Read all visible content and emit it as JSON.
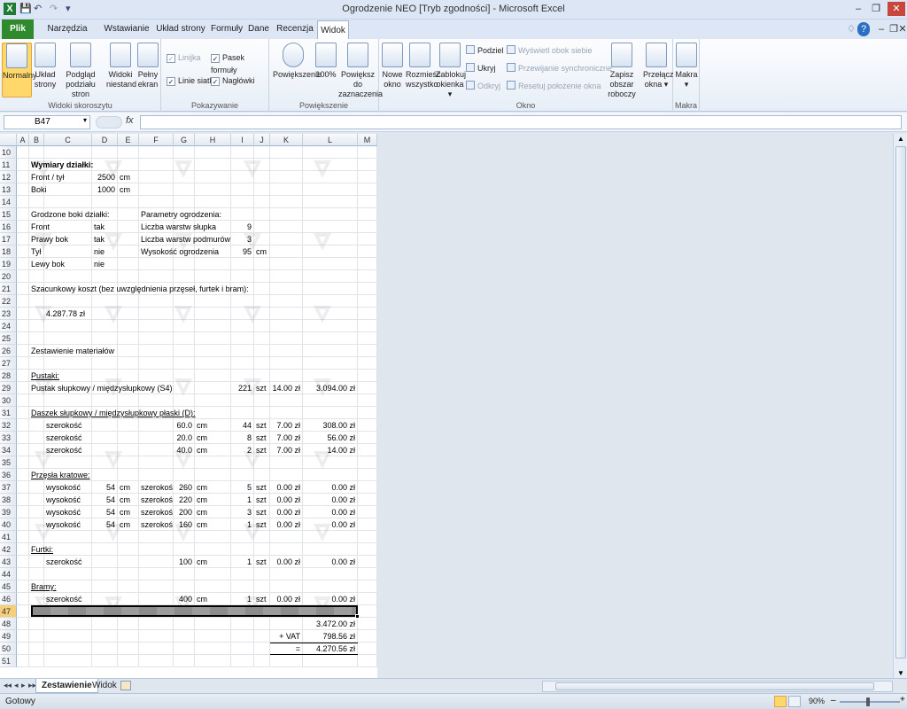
{
  "window": {
    "title": "Ogrodzenie NEO  [Tryb zgodności] - Microsoft Excel",
    "qat": [
      "X",
      "💾",
      "↶",
      "↷",
      "▾"
    ],
    "controls": [
      "–",
      "❐",
      "✕"
    ],
    "ribbon_controls": [
      "♢",
      "?",
      "–",
      "❐",
      "✕"
    ]
  },
  "tabs": [
    "Plik",
    "Narzędzia główne",
    "Wstawianie",
    "Układ strony",
    "Formuły",
    "Dane",
    "Recenzja",
    "Widok"
  ],
  "ribbon": {
    "groups": {
      "views": {
        "label": "Widoki skoroszytu",
        "buttons": [
          "Normalny",
          "Układ strony",
          "Podgląd podziału stron",
          "Widoki niestand",
          "Pełny ekran"
        ]
      },
      "show": {
        "label": "Pokazywanie",
        "ruler": "Linijka",
        "formula_bar": "Pasek formuły",
        "gridlines": "Linie siatki",
        "headings": "Nagłówki"
      },
      "zoom": {
        "label": "Powiększenie",
        "buttons": [
          "Powiększenie",
          "100%",
          "Powiększ do zaznaczenia"
        ]
      },
      "window": {
        "label": "Okno",
        "buttons": [
          "Nowe okno",
          "Rozmieść wszystko",
          "Zablokuj okienka ▾"
        ],
        "split": "Podziel",
        "hide": "Ukryj",
        "unhide": "Odkryj",
        "side_by_side": "Wyświetl obok siebie",
        "sync_scroll": "Przewijanie synchroniczne",
        "reset_pos": "Resetuj położenie okna",
        "save_ws": "Zapisz obszar roboczy",
        "switch": "Przełącz okna ▾"
      },
      "macros": {
        "label": "Makra",
        "button": "Makra ▾"
      }
    }
  },
  "formula_bar": {
    "name_box": "B47",
    "fx": "fx",
    "formula": ""
  },
  "columns": [
    "A",
    "B",
    "C",
    "D",
    "E",
    "F",
    "G",
    "H",
    "I",
    "J",
    "K",
    "L",
    "M"
  ],
  "rows": [
    "10",
    "11",
    "12",
    "13",
    "14",
    "15",
    "16",
    "17",
    "18",
    "19",
    "20",
    "21",
    "22",
    "23",
    "24",
    "25",
    "26",
    "27",
    "28",
    "29",
    "30",
    "31",
    "32",
    "33",
    "34",
    "35",
    "36",
    "37",
    "38",
    "39",
    "40",
    "41",
    "42",
    "43",
    "44",
    "45",
    "46",
    "47",
    "48",
    "49",
    "50",
    "51"
  ],
  "cells": [
    {
      "row": "11",
      "col": "B",
      "text": "Wymiary działki:",
      "b": true
    },
    {
      "row": "12",
      "col": "B",
      "text": "Front / tył"
    },
    {
      "row": "12",
      "col": "D",
      "text": "2500",
      "r": true
    },
    {
      "row": "12",
      "col": "E",
      "text": "cm"
    },
    {
      "row": "13",
      "col": "B",
      "text": "Boki"
    },
    {
      "row": "13",
      "col": "D",
      "text": "1000",
      "r": true
    },
    {
      "row": "13",
      "col": "E",
      "text": "cm"
    },
    {
      "row": "15",
      "col": "B",
      "text": "Grodzone boki działki:"
    },
    {
      "row": "15",
      "col": "F",
      "text": "Parametry ogrodzenia:"
    },
    {
      "row": "16",
      "col": "B",
      "text": "Front"
    },
    {
      "row": "16",
      "col": "D",
      "text": "tak"
    },
    {
      "row": "16",
      "col": "F",
      "text": "Liczba warstw słupka"
    },
    {
      "row": "16",
      "col": "I",
      "text": "9",
      "r": true
    },
    {
      "row": "17",
      "col": "B",
      "text": "Prawy bok"
    },
    {
      "row": "17",
      "col": "D",
      "text": "tak"
    },
    {
      "row": "17",
      "col": "F",
      "text": "Liczba warstw podmurówki"
    },
    {
      "row": "17",
      "col": "I",
      "text": "3",
      "r": true
    },
    {
      "row": "18",
      "col": "B",
      "text": "Tył"
    },
    {
      "row": "18",
      "col": "D",
      "text": "nie"
    },
    {
      "row": "18",
      "col": "F",
      "text": "Wysokość ogrodzenia"
    },
    {
      "row": "18",
      "col": "I",
      "text": "95",
      "r": true
    },
    {
      "row": "18",
      "col": "J",
      "text": "cm"
    },
    {
      "row": "19",
      "col": "B",
      "text": "Lewy bok"
    },
    {
      "row": "19",
      "col": "D",
      "text": "nie"
    },
    {
      "row": "21",
      "col": "B",
      "text": "Szacunkowy koszt (bez uwzględnienia przęseł, furtek i bram):"
    },
    {
      "row": "23",
      "col": "C",
      "text": "4.287.78 zł"
    },
    {
      "row": "26",
      "col": "B",
      "text": "Zestawienie materiałów"
    },
    {
      "row": "28",
      "col": "B",
      "text": "Pustaki:",
      "u": true
    },
    {
      "row": "29",
      "col": "B",
      "text": "Pustak słupkowy / międzysłupkowy (S4)"
    },
    {
      "row": "29",
      "col": "I",
      "text": "221",
      "r": true
    },
    {
      "row": "29",
      "col": "J",
      "text": "szt"
    },
    {
      "row": "29",
      "col": "K",
      "text": "14.00 zł",
      "r": true
    },
    {
      "row": "29",
      "col": "L",
      "text": "3.094.00 zł",
      "r": true
    },
    {
      "row": "31",
      "col": "B",
      "text": "Daszek słupkowy / międzysłupkowy płaski (D):",
      "u": true
    },
    {
      "row": "32",
      "col": "C",
      "text": "szerokość"
    },
    {
      "row": "32",
      "col": "G",
      "text": "60.0",
      "r": true
    },
    {
      "row": "32",
      "col": "H",
      "text": "cm"
    },
    {
      "row": "32",
      "col": "I",
      "text": "44",
      "r": true
    },
    {
      "row": "32",
      "col": "J",
      "text": "szt"
    },
    {
      "row": "32",
      "col": "K",
      "text": "7.00 zł",
      "r": true
    },
    {
      "row": "32",
      "col": "L",
      "text": "308.00 zł",
      "r": true
    },
    {
      "row": "33",
      "col": "C",
      "text": "szerokość"
    },
    {
      "row": "33",
      "col": "G",
      "text": "20.0",
      "r": true
    },
    {
      "row": "33",
      "col": "H",
      "text": "cm"
    },
    {
      "row": "33",
      "col": "I",
      "text": "8",
      "r": true
    },
    {
      "row": "33",
      "col": "J",
      "text": "szt"
    },
    {
      "row": "33",
      "col": "K",
      "text": "7.00 zł",
      "r": true
    },
    {
      "row": "33",
      "col": "L",
      "text": "56.00 zł",
      "r": true
    },
    {
      "row": "34",
      "col": "C",
      "text": "szerokość"
    },
    {
      "row": "34",
      "col": "G",
      "text": "40.0",
      "r": true
    },
    {
      "row": "34",
      "col": "H",
      "text": "cm"
    },
    {
      "row": "34",
      "col": "I",
      "text": "2",
      "r": true
    },
    {
      "row": "34",
      "col": "J",
      "text": "szt"
    },
    {
      "row": "34",
      "col": "K",
      "text": "7.00 zł",
      "r": true
    },
    {
      "row": "34",
      "col": "L",
      "text": "14.00 zł",
      "r": true
    },
    {
      "row": "36",
      "col": "B",
      "text": "Przęsła kratowe:",
      "u": true
    },
    {
      "row": "37",
      "col": "C",
      "text": "wysokość"
    },
    {
      "row": "37",
      "col": "D",
      "text": "54",
      "r": true
    },
    {
      "row": "37",
      "col": "E",
      "text": "cm"
    },
    {
      "row": "37",
      "col": "F",
      "text": "szerokość"
    },
    {
      "row": "37",
      "col": "G",
      "text": "260",
      "r": true
    },
    {
      "row": "37",
      "col": "H",
      "text": "cm"
    },
    {
      "row": "37",
      "col": "I",
      "text": "5",
      "r": true
    },
    {
      "row": "37",
      "col": "J",
      "text": "szt"
    },
    {
      "row": "37",
      "col": "K",
      "text": "0.00 zł",
      "r": true
    },
    {
      "row": "37",
      "col": "L",
      "text": "0.00 zł",
      "r": true
    },
    {
      "row": "38",
      "col": "C",
      "text": "wysokość"
    },
    {
      "row": "38",
      "col": "D",
      "text": "54",
      "r": true
    },
    {
      "row": "38",
      "col": "E",
      "text": "cm"
    },
    {
      "row": "38",
      "col": "F",
      "text": "szerokość"
    },
    {
      "row": "38",
      "col": "G",
      "text": "220",
      "r": true
    },
    {
      "row": "38",
      "col": "H",
      "text": "cm"
    },
    {
      "row": "38",
      "col": "I",
      "text": "1",
      "r": true
    },
    {
      "row": "38",
      "col": "J",
      "text": "szt"
    },
    {
      "row": "38",
      "col": "K",
      "text": "0.00 zł",
      "r": true
    },
    {
      "row": "38",
      "col": "L",
      "text": "0.00 zł",
      "r": true
    },
    {
      "row": "39",
      "col": "C",
      "text": "wysokość"
    },
    {
      "row": "39",
      "col": "D",
      "text": "54",
      "r": true
    },
    {
      "row": "39",
      "col": "E",
      "text": "cm"
    },
    {
      "row": "39",
      "col": "F",
      "text": "szerokość"
    },
    {
      "row": "39",
      "col": "G",
      "text": "200",
      "r": true
    },
    {
      "row": "39",
      "col": "H",
      "text": "cm"
    },
    {
      "row": "39",
      "col": "I",
      "text": "3",
      "r": true
    },
    {
      "row": "39",
      "col": "J",
      "text": "szt"
    },
    {
      "row": "39",
      "col": "K",
      "text": "0.00 zł",
      "r": true
    },
    {
      "row": "39",
      "col": "L",
      "text": "0.00 zł",
      "r": true
    },
    {
      "row": "40",
      "col": "C",
      "text": "wysokość"
    },
    {
      "row": "40",
      "col": "D",
      "text": "54",
      "r": true
    },
    {
      "row": "40",
      "col": "E",
      "text": "cm"
    },
    {
      "row": "40",
      "col": "F",
      "text": "szerokość"
    },
    {
      "row": "40",
      "col": "G",
      "text": "160",
      "r": true
    },
    {
      "row": "40",
      "col": "H",
      "text": "cm"
    },
    {
      "row": "40",
      "col": "I",
      "text": "1",
      "r": true
    },
    {
      "row": "40",
      "col": "J",
      "text": "szt"
    },
    {
      "row": "40",
      "col": "K",
      "text": "0.00 zł",
      "r": true
    },
    {
      "row": "40",
      "col": "L",
      "text": "0.00 zł",
      "r": true
    },
    {
      "row": "42",
      "col": "B",
      "text": "Furtki:",
      "u": true
    },
    {
      "row": "43",
      "col": "C",
      "text": "szerokość"
    },
    {
      "row": "43",
      "col": "G",
      "text": "100",
      "r": true
    },
    {
      "row": "43",
      "col": "H",
      "text": "cm"
    },
    {
      "row": "43",
      "col": "I",
      "text": "1",
      "r": true
    },
    {
      "row": "43",
      "col": "J",
      "text": "szt"
    },
    {
      "row": "43",
      "col": "K",
      "text": "0.00 zł",
      "r": true
    },
    {
      "row": "43",
      "col": "L",
      "text": "0.00 zł",
      "r": true
    },
    {
      "row": "45",
      "col": "B",
      "text": "Bramy:",
      "u": true
    },
    {
      "row": "46",
      "col": "C",
      "text": "szerokość"
    },
    {
      "row": "46",
      "col": "G",
      "text": "400",
      "r": true
    },
    {
      "row": "46",
      "col": "H",
      "text": "cm"
    },
    {
      "row": "46",
      "col": "I",
      "text": "1",
      "r": true
    },
    {
      "row": "46",
      "col": "J",
      "text": "szt"
    },
    {
      "row": "46",
      "col": "K",
      "text": "0.00 zł",
      "r": true
    },
    {
      "row": "46",
      "col": "L",
      "text": "0.00 zł",
      "r": true
    },
    {
      "row": "48",
      "col": "L",
      "text": "3.472.00 zł",
      "r": true
    },
    {
      "row": "49",
      "col": "K",
      "text": "+ VAT",
      "r": true
    },
    {
      "row": "49",
      "col": "L",
      "text": "798.56 zł",
      "r": true
    },
    {
      "row": "50",
      "col": "K",
      "text": "=",
      "r": true
    },
    {
      "row": "50",
      "col": "L",
      "text": "4.270.56 zł",
      "r": true
    }
  ],
  "sheet_tabs": [
    "Zestawienie",
    "Widok"
  ],
  "sheet_nav": [
    "◂◂",
    "◂",
    "▸",
    "▸▸"
  ],
  "status": {
    "ready": "Gotowy",
    "zoom": "90%",
    "zoom_minus": "–",
    "zoom_plus": "+"
  },
  "colors": {
    "file_tab": "#2f8a2e",
    "selected": "#ffd76a"
  }
}
